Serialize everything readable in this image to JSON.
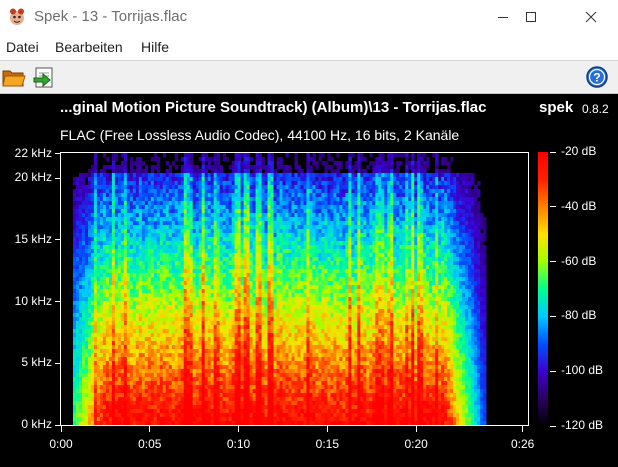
{
  "window": {
    "title": "Spek - 13 - Torrijas.flac",
    "controls": [
      "minimize",
      "maximize",
      "close"
    ]
  },
  "menu": [
    "Datei",
    "Bearbeiten",
    "Hilfe"
  ],
  "toolbar": {
    "buttons": [
      "open-folder-icon",
      "save-export-icon"
    ],
    "help_icon": "help-icon"
  },
  "plot": {
    "title": "...ginal Motion Picture Soundtrack) (Album)\\13 - Torrijas.flac",
    "app_name": "spek",
    "app_version": "0.8.2",
    "subtitle": "FLAC (Free Lossless Audio Codec), 44100 Hz, 16 bits, 2 Kanäle"
  },
  "chart_data": {
    "type": "heatmap",
    "x_ticks": [
      "0:00",
      "0:05",
      "0:10",
      "0:15",
      "0:20",
      "0:26"
    ],
    "x_tick_seconds": [
      0,
      5,
      10,
      15,
      20,
      26
    ],
    "x_range_seconds": [
      0,
      26.3
    ],
    "y_ticks": [
      "0 kHz",
      "5 kHz",
      "10 kHz",
      "15 kHz",
      "20 kHz",
      "22 kHz"
    ],
    "y_tick_khz": [
      0,
      5,
      10,
      15,
      20,
      22
    ],
    "y_range_khz": [
      0,
      22.05
    ],
    "colorbar_ticks": [
      "-20 dB",
      "-40 dB",
      "-60 dB",
      "-80 dB",
      "-100 dB",
      "-120 dB"
    ],
    "colorbar_db": [
      -20,
      -40,
      -60,
      -80,
      -100,
      -120
    ],
    "colorbar_range_db": [
      -120,
      -20
    ],
    "colormap": [
      "#000000",
      "#2a0060",
      "#3a00d0",
      "#0050ff",
      "#00c8ff",
      "#00ff90",
      "#a0ff00",
      "#ffe000",
      "#ff8000",
      "#ff2000",
      "#ff0000"
    ],
    "signal_start_seconds": 0.6,
    "signal_end_seconds": 21.5
  }
}
